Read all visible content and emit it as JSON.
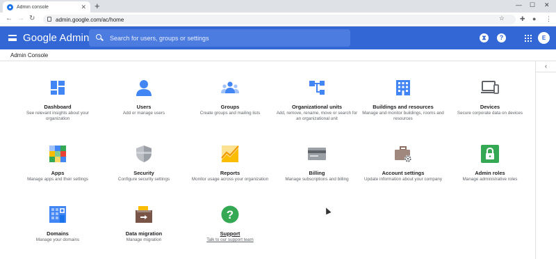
{
  "browser": {
    "tab_title": "Admin console",
    "url": "admin.google.com/ac/home"
  },
  "header": {
    "brand": "Google Admin",
    "search_placeholder": "Search for users, groups or settings",
    "avatar_initial": "E"
  },
  "breadcrumb": "Admin Console",
  "colors": {
    "appbar": "#3367d6",
    "accent_blue": "#4285f4",
    "green": "#34a853",
    "yellow": "#fbbc04",
    "red": "#ea4335"
  },
  "cards": [
    {
      "name": "Dashboard",
      "desc": "See relevant insights about your organization",
      "icon": "dashboard-icon"
    },
    {
      "name": "Users",
      "desc": "Add or manage users",
      "icon": "user-icon"
    },
    {
      "name": "Groups",
      "desc": "Create groups and mailing lists",
      "icon": "groups-icon"
    },
    {
      "name": "Organizational units",
      "desc": "Add, remove, rename, move or search for an organizational unit",
      "icon": "org-units-icon"
    },
    {
      "name": "Buildings and resources",
      "desc": "Manage and monitor buildings, rooms and resources",
      "icon": "building-icon"
    },
    {
      "name": "Devices",
      "desc": "Secure corporate data on devices",
      "icon": "devices-icon"
    },
    {
      "name": "Apps",
      "desc": "Manage apps and their settings",
      "icon": "apps-icon"
    },
    {
      "name": "Security",
      "desc": "Configure security settings",
      "icon": "shield-icon"
    },
    {
      "name": "Reports",
      "desc": "Monitor usage across your organization",
      "icon": "reports-icon"
    },
    {
      "name": "Billing",
      "desc": "Manage subscriptions and billing",
      "icon": "credit-card-icon"
    },
    {
      "name": "Account settings",
      "desc": "Update information about your company",
      "icon": "briefcase-gear-icon"
    },
    {
      "name": "Admin roles",
      "desc": "Manage administrative roles",
      "icon": "lock-icon"
    },
    {
      "name": "Domains",
      "desc": "Manage your domains",
      "icon": "domains-icon"
    },
    {
      "name": "Data migration",
      "desc": "Manage migration",
      "icon": "data-migration-icon"
    },
    {
      "name": "Support",
      "desc": "Talk to our support team",
      "icon": "help-icon"
    }
  ]
}
